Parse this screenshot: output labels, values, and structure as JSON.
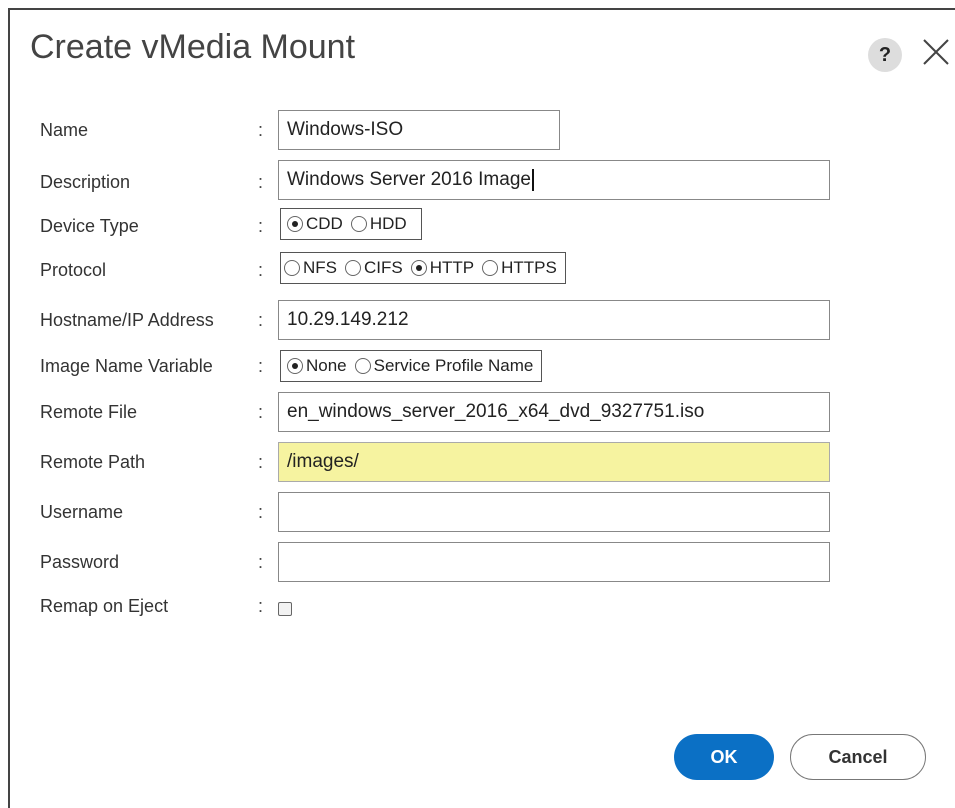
{
  "dialog": {
    "title": "Create vMedia Mount",
    "help_label": "?",
    "ok_label": "OK",
    "cancel_label": "Cancel"
  },
  "labels": {
    "name": "Name",
    "description": "Description",
    "device_type": "Device Type",
    "protocol": "Protocol",
    "hostname": "Hostname/IP Address",
    "image_name_variable": "Image Name Variable",
    "remote_file": "Remote File",
    "remote_path": "Remote Path",
    "username": "Username",
    "password": "Password",
    "remap_on_eject": "Remap on Eject",
    "colon": ":"
  },
  "values": {
    "name": "Windows-ISO",
    "description": "Windows Server 2016 Image",
    "hostname": "10.29.149.212",
    "remote_file": "en_windows_server_2016_x64_dvd_9327751.iso",
    "remote_path": "/images/",
    "username": "",
    "password": "",
    "remap_on_eject": false
  },
  "device_type": {
    "options": [
      "CDD",
      "HDD"
    ],
    "selected": "CDD"
  },
  "protocol": {
    "options": [
      "NFS",
      "CIFS",
      "HTTP",
      "HTTPS"
    ],
    "selected": "HTTP"
  },
  "image_name_variable": {
    "options": [
      "None",
      "Service Profile Name"
    ],
    "selected": "None"
  },
  "colors": {
    "primary_button": "#0b70c5",
    "highlight_field": "#f6f3a0"
  }
}
